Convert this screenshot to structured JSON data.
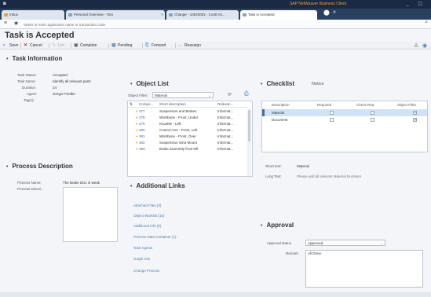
{
  "window": {
    "title": "SAP NetWeaver Business Client"
  },
  "tabs": [
    {
      "label": "Inbox"
    },
    {
      "label": "Personal Overview - Tom"
    },
    {
      "label": "Change - 10020001 - Contl A0..."
    },
    {
      "label": "Task is Accepted"
    }
  ],
  "address": {
    "placeholder": "Select or enter application name or transaction code"
  },
  "page": {
    "title": "Task is Accepted"
  },
  "toolbar": {
    "save": "Save",
    "cancel": "Cancel",
    "list": "List",
    "complete": "Complete",
    "pending": "Pending",
    "forward": "Forward",
    "reassign": "Reassign"
  },
  "task_info": {
    "title": "Task Information",
    "fields": [
      {
        "label": "Task Status:",
        "value": "Accepted"
      },
      {
        "label": "Task Name:",
        "value": "Identify all relevant parts"
      },
      {
        "label": "Duration:",
        "value": "24"
      },
      {
        "label": "Agent:",
        "value": "Gregor Fiedler"
      },
      {
        "label": "Tag(s):",
        "value": ""
      }
    ]
  },
  "process": {
    "title": "Process Description",
    "name_label": "Process Name:",
    "name_value": "The Brake Disc is weak",
    "desc_label": "Process Descri..."
  },
  "object_list": {
    "title": "Object List",
    "filter_label": "Object Filter:",
    "filter_value": "Material",
    "columns": [
      "Compo...",
      "Short description",
      "Relevan..."
    ],
    "rows": [
      {
        "id": "377",
        "desc": "Suspension and Brakes",
        "rel": "Informat..."
      },
      {
        "id": "378",
        "desc": "Wishbone - Front, Under",
        "rel": "Informat..."
      },
      {
        "id": "379",
        "desc": "Knuckle - Left",
        "rel": "Informat..."
      },
      {
        "id": "380",
        "desc": "Control Arm - Front, Left",
        "rel": "Informat..."
      },
      {
        "id": "381",
        "desc": "Wishbone - Front, Over",
        "rel": "Informat..."
      },
      {
        "id": "382",
        "desc": "Suspension Strut Mount",
        "rel": "Informat..."
      },
      {
        "id": "383",
        "desc": "Brake assembly front left",
        "rel": "Informat..."
      }
    ]
  },
  "links": {
    "title": "Additional Links",
    "items": [
      "Attached Files (0)",
      "Object Worklist (10)",
      "Additional Info (0)",
      "Process Data Container (1)",
      "Task Agents",
      "Graph Info",
      "Change Process"
    ]
  },
  "checklist": {
    "title": "Checklist",
    "notice_tab": "Notice",
    "columns": [
      "Description",
      "Required",
      "Check Req",
      "Object Filter"
    ],
    "rows": [
      {
        "desc": "Material",
        "required": false,
        "check": false,
        "filter": true
      },
      {
        "desc": "Document",
        "required": false,
        "check": false,
        "filter": true
      }
    ],
    "short_text_label": "Short text:",
    "short_text_value": "Material",
    "long_text_label": "Long Text:",
    "long_text_value": "Please add all relevant Material Numbers"
  },
  "approval": {
    "title": "Approval",
    "status_label": "Approval status",
    "status_value": "Approved",
    "remark_label": "Remark",
    "remark_value": "All Done"
  }
}
